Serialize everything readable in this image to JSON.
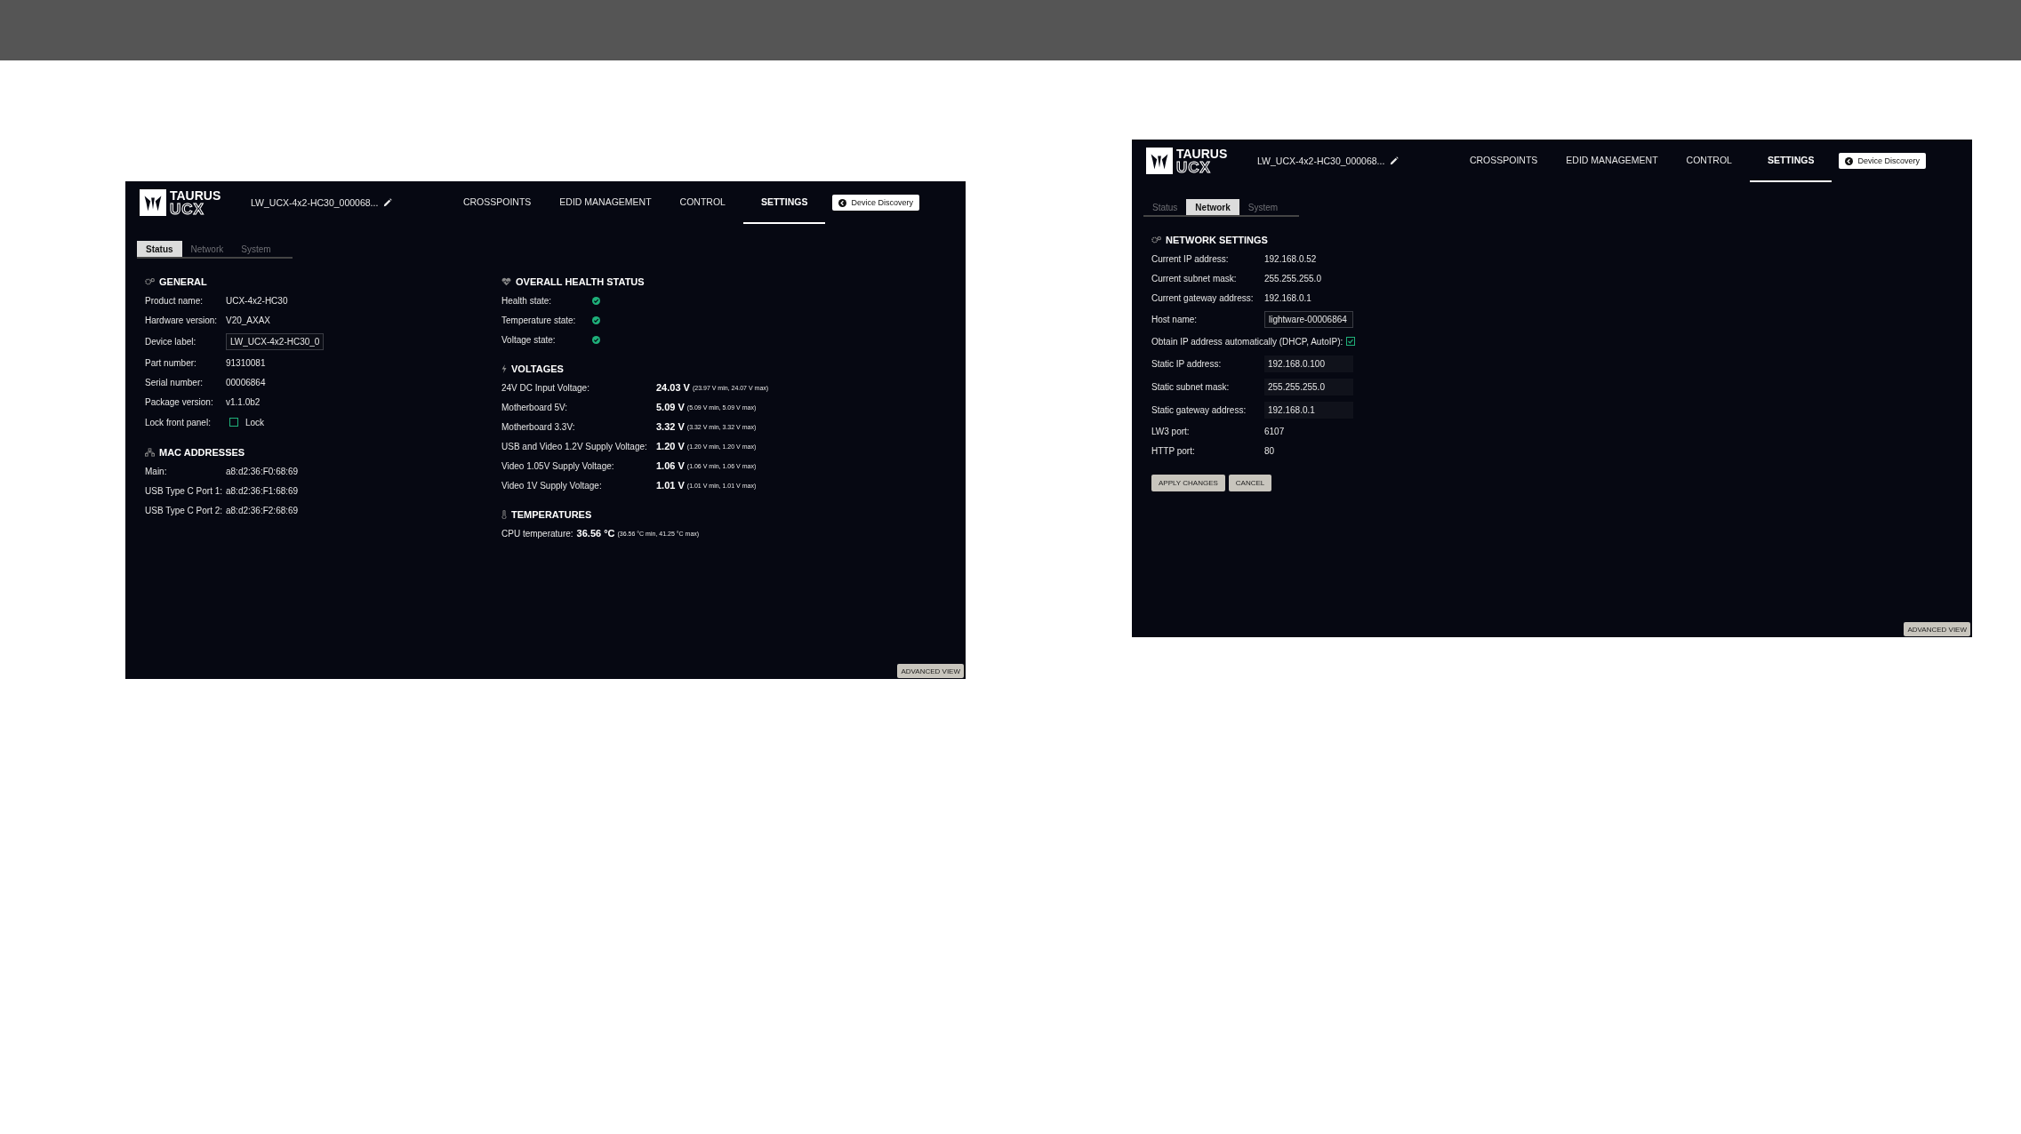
{
  "panels": [
    {
      "header": {
        "logo": {
          "top": "TAURUS",
          "bottom": "UCX"
        },
        "device_name": "LW_UCX-4x2-HC30_000068...",
        "nav": [
          {
            "label": "CROSSPOINTS",
            "selected": false
          },
          {
            "label": "EDID MANAGEMENT",
            "selected": false
          },
          {
            "label": "CONTROL",
            "selected": false
          },
          {
            "label": "SETTINGS",
            "selected": true
          }
        ],
        "discovery_button": "Device Discovery"
      },
      "subtabs": [
        {
          "label": "Status",
          "selected": true
        },
        {
          "label": "Network",
          "selected": false
        },
        {
          "label": "System",
          "selected": false
        }
      ],
      "columns": [
        [
          {
            "kind": "general",
            "title": "GENERAL",
            "rows": [
              {
                "kind": "text",
                "label": "Product name:",
                "value": "UCX-4x2-HC30"
              },
              {
                "kind": "text",
                "label": "Hardware version:",
                "value": "V20_AXAX"
              },
              {
                "kind": "field",
                "label": "Device label:",
                "value": "LW_UCX-4x2-HC30_0"
              },
              {
                "kind": "text",
                "label": "Part number:",
                "value": "91310081"
              },
              {
                "kind": "text",
                "label": "Serial number:",
                "value": "00006864"
              },
              {
                "kind": "text",
                "label": "Package version:",
                "value": "v1.1.0b2"
              },
              {
                "kind": "checkbox",
                "label": "Lock front panel:",
                "checked": false,
                "value": "Lock"
              }
            ]
          },
          {
            "kind": "mac",
            "title": "MAC ADDRESSES",
            "rows": [
              {
                "kind": "text",
                "label": "Main:",
                "value": "a8:d2:36:F0:68:69"
              },
              {
                "kind": "text",
                "label": "USB Type C Port 1:",
                "value": "a8:d2:36:F1:68:69"
              },
              {
                "kind": "text",
                "label": "USB Type C Port 2:",
                "value": "a8:d2:36:F2:68:69"
              }
            ]
          }
        ],
        [
          {
            "kind": "health",
            "title": "OVERALL HEALTH STATUS",
            "rows": [
              {
                "kind": "health",
                "label": "Health state:",
                "ok": true
              },
              {
                "kind": "health",
                "label": "Temperature state:",
                "ok": true
              },
              {
                "kind": "health",
                "label": "Voltage state:",
                "ok": true
              }
            ]
          },
          {
            "kind": "voltages",
            "title": "VOLTAGES",
            "rows": [
              {
                "kind": "reading",
                "label": "24V DC Input Voltage:",
                "value": "24.03 V",
                "range": "(23.97 V min, 24.07 V max)"
              },
              {
                "kind": "reading",
                "label": "Motherboard 5V:",
                "value": "5.09 V",
                "range": "(5.09 V min, 5.09 V max)"
              },
              {
                "kind": "reading",
                "label": "Motherboard 3.3V:",
                "value": "3.32 V",
                "range": "(3.32 V min, 3.32 V max)"
              },
              {
                "kind": "reading",
                "label": "USB and Video 1.2V Supply Voltage:",
                "value": "1.20 V",
                "range": "(1.20 V min, 1.20 V max)"
              },
              {
                "kind": "reading",
                "label": "Video 1.05V Supply Voltage:",
                "value": "1.06 V",
                "range": "(1.06 V min, 1.06 V max)"
              },
              {
                "kind": "reading",
                "label": "Video 1V Supply Voltage:",
                "value": "1.01 V",
                "range": "(1.01 V min, 1.01 V max)"
              }
            ]
          },
          {
            "kind": "temperatures",
            "title": "TEMPERATURES",
            "rows": [
              {
                "kind": "reading",
                "label": "CPU temperature:",
                "value": "36.56 °C",
                "range": "(36.56 °C min, 41.25 °C max)"
              }
            ]
          }
        ]
      ],
      "advanced_button": "ADVANCED VIEW"
    },
    {
      "header": {
        "logo": {
          "top": "TAURUS",
          "bottom": "UCX"
        },
        "device_name": "LW_UCX-4x2-HC30_000068...",
        "nav": [
          {
            "label": "CROSSPOINTS",
            "selected": false
          },
          {
            "label": "EDID MANAGEMENT",
            "selected": false
          },
          {
            "label": "CONTROL",
            "selected": false
          },
          {
            "label": "SETTINGS",
            "selected": true
          }
        ],
        "discovery_button": "Device Discovery"
      },
      "subtabs": [
        {
          "label": "Status",
          "selected": false
        },
        {
          "label": "Network",
          "selected": true
        },
        {
          "label": "System",
          "selected": false
        }
      ],
      "columns": [
        [
          {
            "kind": "network",
            "title": "NETWORK SETTINGS",
            "rows": [
              {
                "kind": "text",
                "label": "Current IP address:",
                "value": "192.168.0.52"
              },
              {
                "kind": "text",
                "label": "Current subnet mask:",
                "value": "255.255.255.0"
              },
              {
                "kind": "text",
                "label": "Current gateway address:",
                "value": "192.168.0.1"
              },
              {
                "kind": "field",
                "label": "Host name:",
                "value": "lightware-00006864"
              },
              {
                "kind": "checkbox",
                "label": "Obtain IP address automatically (DHCP, AutoIP):",
                "checked": true
              },
              {
                "kind": "input",
                "label": "Static IP address:",
                "value": "192.168.0.100"
              },
              {
                "kind": "input",
                "label": "Static subnet mask:",
                "value": "255.255.255.0"
              },
              {
                "kind": "input",
                "label": "Static gateway address:",
                "value": "192.168.0.1"
              },
              {
                "kind": "text",
                "label": "LW3 port:",
                "value": "6107"
              },
              {
                "kind": "text",
                "label": "HTTP port:",
                "value": "80"
              }
            ],
            "buttons": [
              "APPLY CHANGES",
              "CANCEL"
            ]
          }
        ]
      ],
      "advanced_button": "ADVANCED VIEW"
    }
  ]
}
